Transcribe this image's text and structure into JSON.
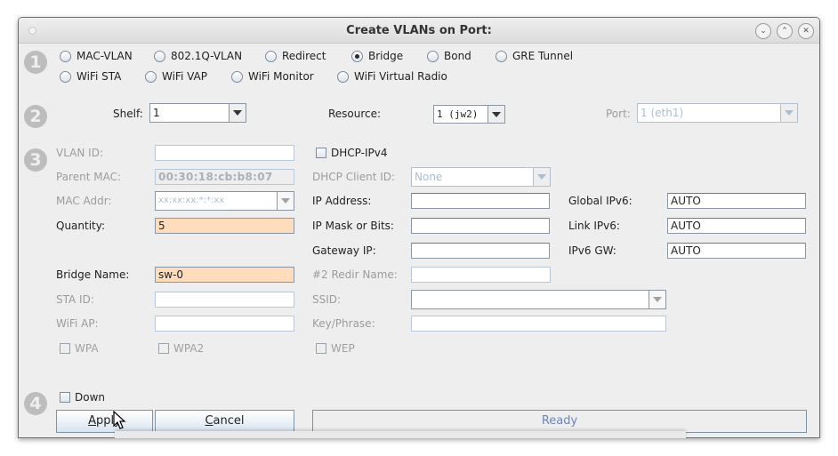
{
  "window": {
    "title": "Create VLANs on Port:",
    "controls": [
      "minimize",
      "maximize",
      "close"
    ]
  },
  "steps": [
    "1",
    "2",
    "3",
    "4"
  ],
  "type_options": {
    "row1": [
      {
        "label": "MAC-VLAN",
        "selected": false
      },
      {
        "label": "802.1Q-VLAN",
        "selected": false
      },
      {
        "label": "Redirect",
        "selected": false
      },
      {
        "label": "Bridge",
        "selected": true
      },
      {
        "label": "Bond",
        "selected": false
      },
      {
        "label": "GRE Tunnel",
        "selected": false
      }
    ],
    "row2": [
      {
        "label": "WiFi STA",
        "selected": false
      },
      {
        "label": "WiFi VAP",
        "selected": false
      },
      {
        "label": "WiFi Monitor",
        "selected": false
      },
      {
        "label": "WiFi Virtual Radio",
        "selected": false
      }
    ]
  },
  "location": {
    "shelf_label": "Shelf:",
    "shelf_value": "1",
    "resource_label": "Resource:",
    "resource_value": "1 (jw2)",
    "port_label": "Port:",
    "port_value": "1 (eth1)"
  },
  "form": {
    "vlan_id_label": "VLAN ID:",
    "vlan_id_value": "",
    "parent_mac_label": "Parent MAC:",
    "parent_mac_value": "00:30:18:cb:b8:07",
    "mac_addr_label": "MAC Addr:",
    "mac_addr_value": "xx:xx:xx:*:*:xx",
    "quantity_label": "Quantity:",
    "quantity_value": "5",
    "bridge_name_label": "Bridge Name:",
    "bridge_name_value": "sw-0",
    "sta_id_label": "STA ID:",
    "sta_id_value": "",
    "wifi_ap_label": "WiFi AP:",
    "wifi_ap_value": "",
    "wpa_label": "WPA",
    "wpa2_label": "WPA2",
    "dhcp_ipv4_label": "DHCP-IPv4",
    "dhcp_client_id_label": "DHCP Client ID:",
    "dhcp_client_id_value": "None",
    "ip_address_label": "IP Address:",
    "ip_address_value": "",
    "ip_mask_label": "IP Mask or Bits:",
    "ip_mask_value": "",
    "gateway_ip_label": "Gateway IP:",
    "gateway_ip_value": "",
    "redir_name_label": "#2 Redir Name:",
    "redir_name_value": "",
    "ssid_label": "SSID:",
    "ssid_value": "",
    "key_phrase_label": "Key/Phrase:",
    "key_phrase_value": "",
    "wep_label": "WEP",
    "global_ipv6_label": "Global IPv6:",
    "global_ipv6_value": "AUTO",
    "link_ipv6_label": "Link IPv6:",
    "link_ipv6_value": "AUTO",
    "ipv6_gw_label": "IPv6 GW:",
    "ipv6_gw_value": "AUTO"
  },
  "footer": {
    "down_label": "Down",
    "apply_mnemonic": "A",
    "apply_rest": "pply",
    "cancel_mnemonic": "C",
    "cancel_rest": "ancel",
    "status": "Ready"
  }
}
